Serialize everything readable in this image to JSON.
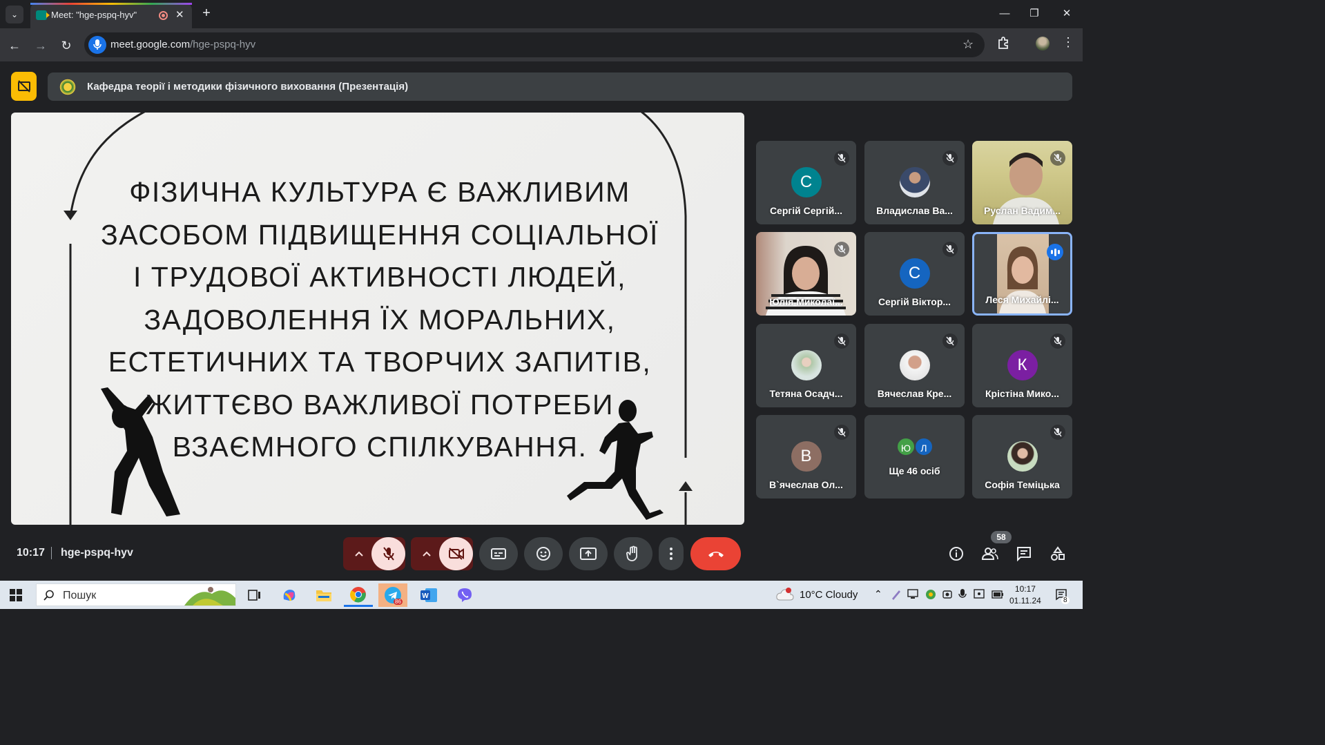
{
  "browser": {
    "tab_title": "Meet: \"hge-pspq-hyv\"",
    "tab_close": "✕",
    "new_tab": "+",
    "url_host": "meet.google.com",
    "url_path": "/hge-pspq-hyv",
    "window_minimize": "—",
    "window_restore": "❐",
    "window_close": "✕"
  },
  "meet": {
    "presentation_title": "Кафедра теорії і методики фізичного виховання (Презентація)",
    "slide_text": "ФІЗИЧНА КУЛЬТУРА Є ВАЖЛИВИМ\nЗАСОБОМ ПІДВИЩЕННЯ СОЦІАЛЬНОЇ\nІ ТРУДОВОЇ АКТИВНОСТІ ЛЮДЕЙ,\nЗАДОВОЛЕННЯ ЇХ МОРАЛЬНИХ,\nЕСТЕТИЧНИХ ТА ТВОРЧИХ ЗАПИТІВ,\nЖИТТЄВО ВАЖЛИВОЇ ПОТРЕБИ\nВЗАЄМНОГО СПІЛКУВАННЯ.",
    "participants": [
      {
        "name": "Сергій Сергій...",
        "initial": "С",
        "color": "#00838f",
        "kind": "letter",
        "muted": true
      },
      {
        "name": "Владислав Ва...",
        "kind": "photo",
        "muted": true
      },
      {
        "name": "Руслан Вадим...",
        "kind": "video",
        "muted": true
      },
      {
        "name": "Юлія Миколаї...",
        "kind": "video",
        "muted": true
      },
      {
        "name": "Сергій Віктор...",
        "initial": "С",
        "color": "#1565c0",
        "kind": "letter",
        "muted": true
      },
      {
        "name": "Леся Михайлі...",
        "kind": "video",
        "muted": false,
        "speaking": true
      },
      {
        "name": "Тетяна Осадч...",
        "kind": "photo",
        "muted": true
      },
      {
        "name": "Вячеслав Кре...",
        "kind": "photo",
        "muted": true
      },
      {
        "name": "Крістіна Мико...",
        "initial": "К",
        "color": "#7b1fa2",
        "kind": "letter",
        "muted": true
      },
      {
        "name": "В`ячеслав Ол...",
        "initial": "В",
        "color": "#8d6e63",
        "kind": "letter",
        "muted": true
      },
      {
        "name": "Ще 46 осіб",
        "kind": "more",
        "initials": [
          "Ю",
          "Л"
        ]
      },
      {
        "name": "Софія Теміцька",
        "kind": "photo",
        "muted": true
      }
    ],
    "time": "10:17",
    "meeting_code": "hge-pspq-hyv",
    "people_count": "58"
  },
  "taskbar": {
    "search_label": "Пошук",
    "weather": "10°C  Cloudy",
    "time": "10:17",
    "date": "01.11.24",
    "telegram_badge": "86",
    "notification_count": "8"
  }
}
